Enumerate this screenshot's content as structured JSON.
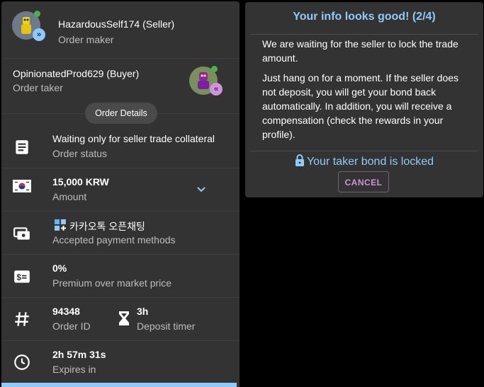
{
  "order": {
    "maker": {
      "name": "HazardousSelf174 (Seller)",
      "role": "Order maker"
    },
    "taker": {
      "name": "OpinionatedProd629 (Buyer)",
      "role": "Order taker"
    },
    "details_chip": "Order Details",
    "status": {
      "value": "Waiting only for seller trade collateral",
      "label": "Order status"
    },
    "amount": {
      "value": "15,000 KRW",
      "label": "Amount",
      "flag_icon": "korea-flag-icon"
    },
    "payment": {
      "value": "카카오톡 오픈채팅",
      "label": "Accepted payment methods"
    },
    "premium": {
      "value": "0%",
      "label": "Premium over market price"
    },
    "order_id": {
      "value": "94348",
      "label": "Order ID"
    },
    "deposit_timer": {
      "value": "3h",
      "label": "Deposit timer"
    },
    "expires": {
      "value": "2h 57m 31s",
      "label": "Expires in"
    }
  },
  "info_panel": {
    "title": "Your info looks good! (2/4)",
    "paragraph1": "We are waiting for the seller to lock the trade amount.",
    "paragraph2": "Just hang on for a moment. If the seller does not deposit, you will get your bond back automatically. In addition, you will receive a compensation (check the rewards in your profile).",
    "bond_status": "Your taker bond is locked",
    "cancel_label": "CANCEL"
  },
  "colors": {
    "accent_blue": "#90caf9",
    "accent_purple": "#ce93d8",
    "panel_bg": "#333333",
    "online_green": "#4caf50"
  }
}
